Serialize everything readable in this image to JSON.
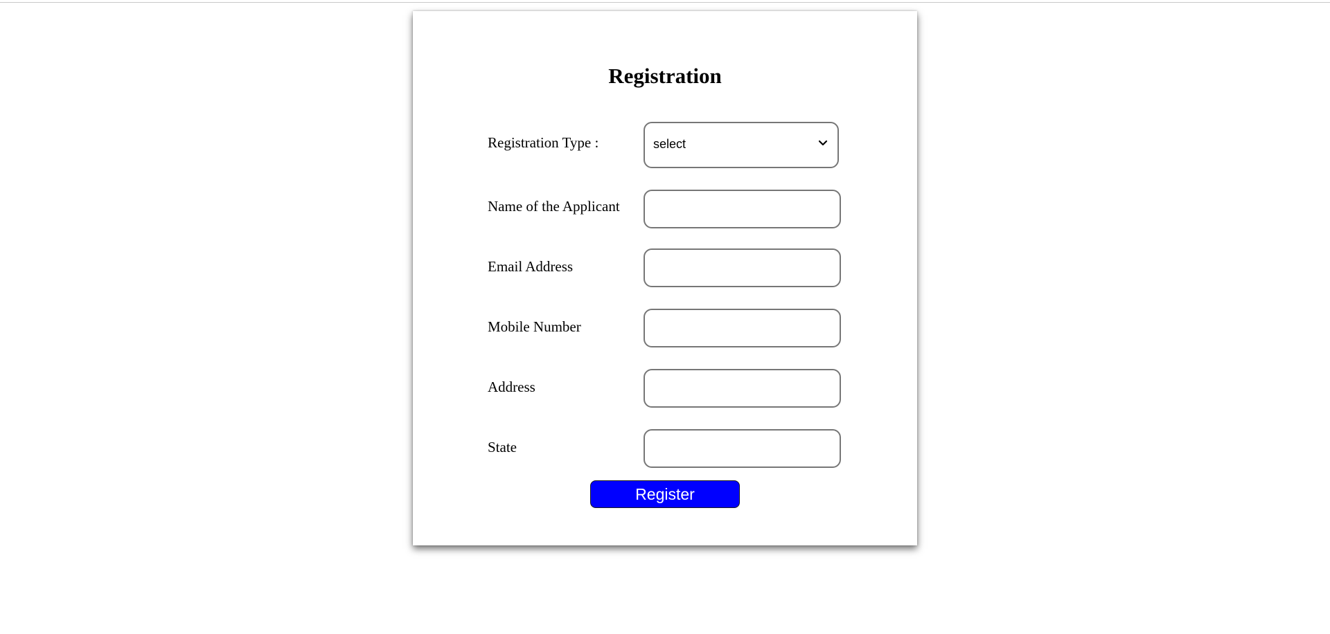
{
  "form": {
    "title": "Registration",
    "registration_type": {
      "label": "Registration Type :",
      "selected": "select"
    },
    "fields": [
      {
        "label": "Name of the Applicant",
        "value": ""
      },
      {
        "label": "Email Address",
        "value": ""
      },
      {
        "label": "Mobile Number",
        "value": ""
      },
      {
        "label": "Address",
        "value": ""
      },
      {
        "label": "State",
        "value": ""
      }
    ],
    "submit_label": "Register"
  },
  "colors": {
    "button_bg": "#0000ff",
    "button_text": "#ffffff",
    "input_border": "#767676"
  },
  "icons": {
    "dropdown": "chevron-down-icon"
  }
}
